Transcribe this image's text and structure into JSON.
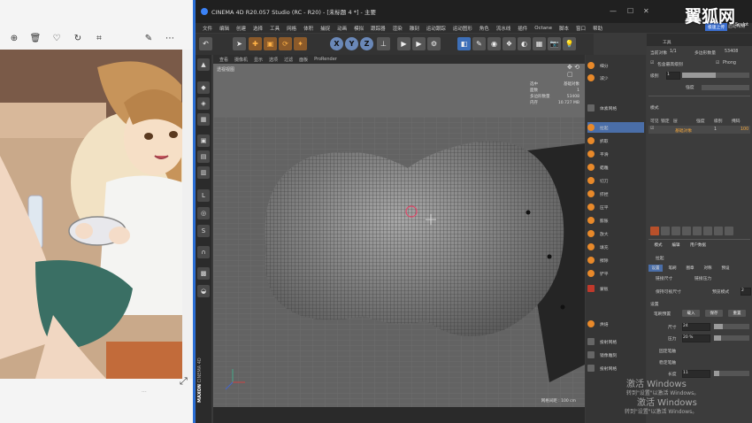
{
  "viewer": {
    "faded_text": "...",
    "toolbar_icons": [
      "zoom-in-icon",
      "delete-icon",
      "heart-icon",
      "rotate-icon",
      "crop-icon",
      "edit-icon",
      "more-icon"
    ]
  },
  "window": {
    "title": "CINEMA 4D R20.057 Studio (RC - R20) - [未标题 4 *] - 主要",
    "min_glyph": "—",
    "max_glyph": "☐",
    "close_glyph": "✕"
  },
  "menubar": [
    "文件",
    "编辑",
    "创建",
    "选择",
    "工具",
    "网格",
    "体积",
    "捕捉",
    "动画",
    "模拟",
    "跟踪器",
    "渲染",
    "雕刻",
    "运动跟踪",
    "运动图形",
    "角色",
    "流水线",
    "插件",
    "Octane",
    "脚本",
    "窗口",
    "帮助"
  ],
  "toolbar": {
    "axis_x": "X",
    "axis_y": "Y",
    "axis_z": "Z"
  },
  "viewport": {
    "menu": [
      "查看",
      "摄像机",
      "显示",
      "选项",
      "过滤",
      "面板",
      "ProRender"
    ],
    "label": "透视视图",
    "stats": [
      {
        "k": "选中",
        "v": "基础对象"
      },
      {
        "k": "面数",
        "v": "1"
      },
      {
        "k": "多边形数量",
        "v": "53408"
      },
      {
        "k": "内存",
        "v": "10.727 MB"
      }
    ],
    "grid_info": "网格间距 : 100 cm"
  },
  "side_labels": {
    "brand": "MAXON",
    "product": "CINEMA 4D"
  },
  "midpanel": {
    "items": [
      {
        "label": "细分",
        "style": "orange"
      },
      {
        "label": "减少",
        "style": "orange"
      },
      {
        "label": "",
        "style": "blank"
      },
      {
        "label": "体素网格",
        "style": "sq"
      },
      {
        "label": "拉起",
        "style": "sel"
      },
      {
        "label": "抓取",
        "style": "orange"
      },
      {
        "label": "平滑",
        "style": "orange"
      },
      {
        "label": "蜡雕",
        "style": "orange"
      },
      {
        "label": "切刀",
        "style": "orange"
      },
      {
        "label": "挤捏",
        "style": "orange"
      },
      {
        "label": "压平",
        "style": "orange"
      },
      {
        "label": "膨胀",
        "style": "orange"
      },
      {
        "label": "放大",
        "style": "orange"
      },
      {
        "label": "填充",
        "style": "orange"
      },
      {
        "label": "擦除",
        "style": "orange"
      },
      {
        "label": "铲平",
        "style": "orange"
      },
      {
        "label": "蒙板",
        "style": "red"
      },
      {
        "label": "",
        "style": "blank"
      },
      {
        "label": "烘焙",
        "style": "orange"
      },
      {
        "label": "",
        "style": "blank"
      },
      {
        "label": "投射网格",
        "style": "sq"
      },
      {
        "label": "镜像雕刻",
        "style": "sq"
      },
      {
        "label": "投射网格",
        "style": "sq"
      }
    ]
  },
  "rpanel": {
    "sculpt_label": "Sculpt",
    "layout_label": "启动布局",
    "tools_label": "工具",
    "selected_count_label": "当前对象",
    "selected_count": "1/1",
    "polycount_label": "多边形数量",
    "polycount": "53408",
    "check_label": "包含最高级别",
    "phong_label": "Phong",
    "level_label": "级别",
    "level_value": "1",
    "strength_label": "强度",
    "mode_label": "模式",
    "layer_cols": [
      "可见",
      "锁定",
      "层",
      "强度",
      "级别",
      "掩码"
    ],
    "layer_row": {
      "name": "基础对象",
      "value": "1",
      "strength": "100"
    },
    "tabs": [
      "模式",
      "编辑",
      "用户数据"
    ],
    "tool_name": "拉起",
    "subtabs": [
      "设置",
      "笔刷",
      "图章",
      "对称",
      "预设"
    ],
    "link_size": "链接尺寸",
    "link_pressure": "链接压力",
    "keep_visible": "保持可视尺寸",
    "preview_mode": "预览模式",
    "preview_value": "2",
    "settings_label": "设置",
    "brush_preset": "笔刷预置",
    "load": "载入",
    "save": "保存",
    "reset": "重置",
    "size_label": "尺寸",
    "size_value": "24",
    "pressure_label": "压力",
    "pressure_value": "20 %",
    "fixed_pen_label": "固定笔触",
    "stamp_label": "稳定笔触",
    "length_label": "长度",
    "length_value": "11"
  },
  "overlay": {
    "brand_text": "翼狐网",
    "top_badge": "极速上传",
    "activate_1": "激活 Windows",
    "activate_2": "转到\"设置\"以激活 Windows。",
    "activate_3": "激活 Windows",
    "activate_4": "转到\"设置\"以激活 Windows。"
  }
}
